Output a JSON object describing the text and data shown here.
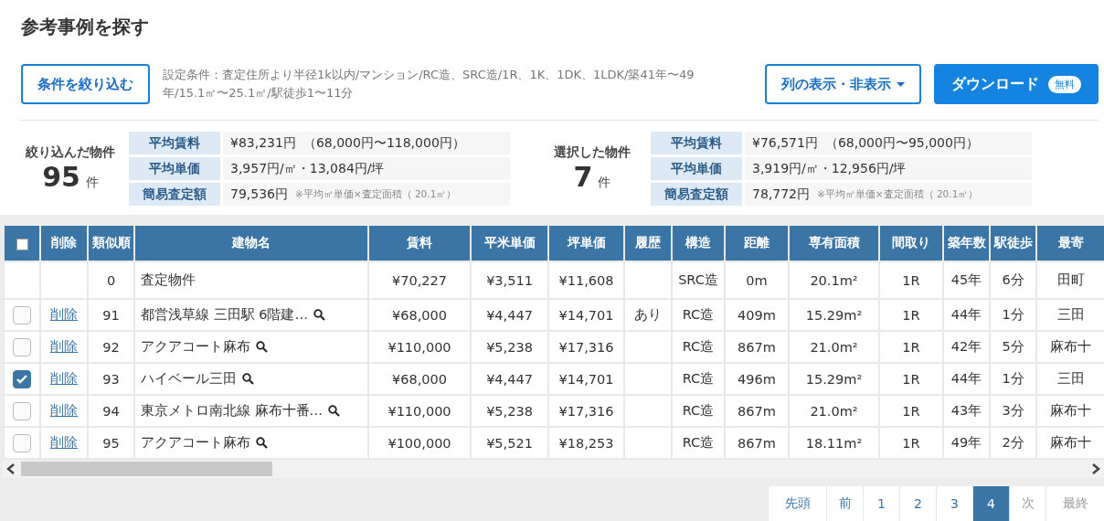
{
  "title": "参考事例を探す",
  "filter_button": "条件を絞り込む",
  "conditions": "設定条件：査定住所より半径1k以内/マンション/RC造、SRC造/1R、1K、1DK、1LDK/築41年〜49年/15.1㎡〜25.1㎡/駅徒歩1〜11分",
  "columns_button": "列の表示・非表示",
  "download_button": {
    "label": "ダウンロード",
    "badge": "無料"
  },
  "summaries": [
    {
      "label": "絞り込んだ物件",
      "count": "95",
      "unit": "件",
      "rows": [
        {
          "label": "平均賃料",
          "value": "¥83,231円",
          "note": "（68,000円〜118,000円）"
        },
        {
          "label": "平均単価",
          "value": "3,957円/㎡・13,084円/坪"
        },
        {
          "label": "簡易査定額",
          "value": "79,536円",
          "small": "※平均㎡単価×査定面積（ 20.1㎡）"
        }
      ]
    },
    {
      "label": "選択した物件",
      "count": "7",
      "unit": "件",
      "rows": [
        {
          "label": "平均賃料",
          "value": "¥76,571円",
          "note": "（68,000円〜95,000円）"
        },
        {
          "label": "平均単価",
          "value": "3,919円/㎡・12,956円/坪"
        },
        {
          "label": "簡易査定額",
          "value": "78,772円",
          "small": "※平均㎡単価×査定面積（ 20.1㎡）"
        }
      ]
    }
  ],
  "table": {
    "select_all": {
      "checked": false
    },
    "columns": [
      "削除",
      "類似順",
      "建物名",
      "賃料",
      "平米単価",
      "坪単価",
      "履歴",
      "構造",
      "距離",
      "専有面積",
      "間取り",
      "築年数",
      "駅徒歩",
      "最寄"
    ],
    "rows": [
      {
        "kind": "reference",
        "rank": "0",
        "name": "査定物件",
        "rent": "¥70,227",
        "sqm": "¥3,511",
        "tsubo": "¥11,608",
        "history": "",
        "structure": "SRC造",
        "distance": "0m",
        "area": "20.1m²",
        "layout": "1R",
        "age": "45年",
        "walk": "6分",
        "station": "田町"
      },
      {
        "kind": "listing",
        "checked": false,
        "delete": "削除",
        "rank": "91",
        "name": "都営浅草線 三田駅 6階建…",
        "rent": "¥68,000",
        "sqm": "¥4,447",
        "tsubo": "¥14,701",
        "history": "あり",
        "structure": "RC造",
        "distance": "409m",
        "area": "15.29m²",
        "layout": "1R",
        "age": "44年",
        "walk": "1分",
        "station": "三田"
      },
      {
        "kind": "listing",
        "checked": false,
        "delete": "削除",
        "rank": "92",
        "name": "アクアコート麻布",
        "rent": "¥110,000",
        "sqm": "¥5,238",
        "tsubo": "¥17,316",
        "history": "",
        "structure": "RC造",
        "distance": "867m",
        "area": "21.0m²",
        "layout": "1R",
        "age": "42年",
        "walk": "5分",
        "station": "麻布十"
      },
      {
        "kind": "listing",
        "checked": true,
        "delete": "削除",
        "rank": "93",
        "name": "ハイベール三田",
        "rent": "¥68,000",
        "sqm": "¥4,447",
        "tsubo": "¥14,701",
        "history": "",
        "structure": "RC造",
        "distance": "496m",
        "area": "15.29m²",
        "layout": "1R",
        "age": "44年",
        "walk": "1分",
        "station": "三田"
      },
      {
        "kind": "listing",
        "checked": false,
        "delete": "削除",
        "rank": "94",
        "name": "東京メトロ南北線 麻布十番…",
        "rent": "¥110,000",
        "sqm": "¥5,238",
        "tsubo": "¥17,316",
        "history": "",
        "structure": "RC造",
        "distance": "867m",
        "area": "21.0m²",
        "layout": "1R",
        "age": "43年",
        "walk": "3分",
        "station": "麻布十"
      },
      {
        "kind": "listing",
        "checked": false,
        "delete": "削除",
        "rank": "95",
        "name": "アクアコート麻布",
        "rent": "¥100,000",
        "sqm": "¥5,521",
        "tsubo": "¥18,253",
        "history": "",
        "structure": "RC造",
        "distance": "867m",
        "area": "18.11m²",
        "layout": "1R",
        "age": "49年",
        "walk": "2分",
        "station": "麻布十"
      }
    ]
  },
  "pagination": [
    {
      "label": "先頭",
      "selected": false,
      "disabled": false
    },
    {
      "label": "前",
      "selected": false,
      "disabled": false
    },
    {
      "label": "1",
      "selected": false,
      "disabled": false
    },
    {
      "label": "2",
      "selected": false,
      "disabled": false
    },
    {
      "label": "3",
      "selected": false,
      "disabled": false
    },
    {
      "label": "4",
      "selected": true,
      "disabled": false
    },
    {
      "label": "次",
      "selected": false,
      "disabled": true
    },
    {
      "label": "最終",
      "selected": false,
      "disabled": true
    }
  ]
}
